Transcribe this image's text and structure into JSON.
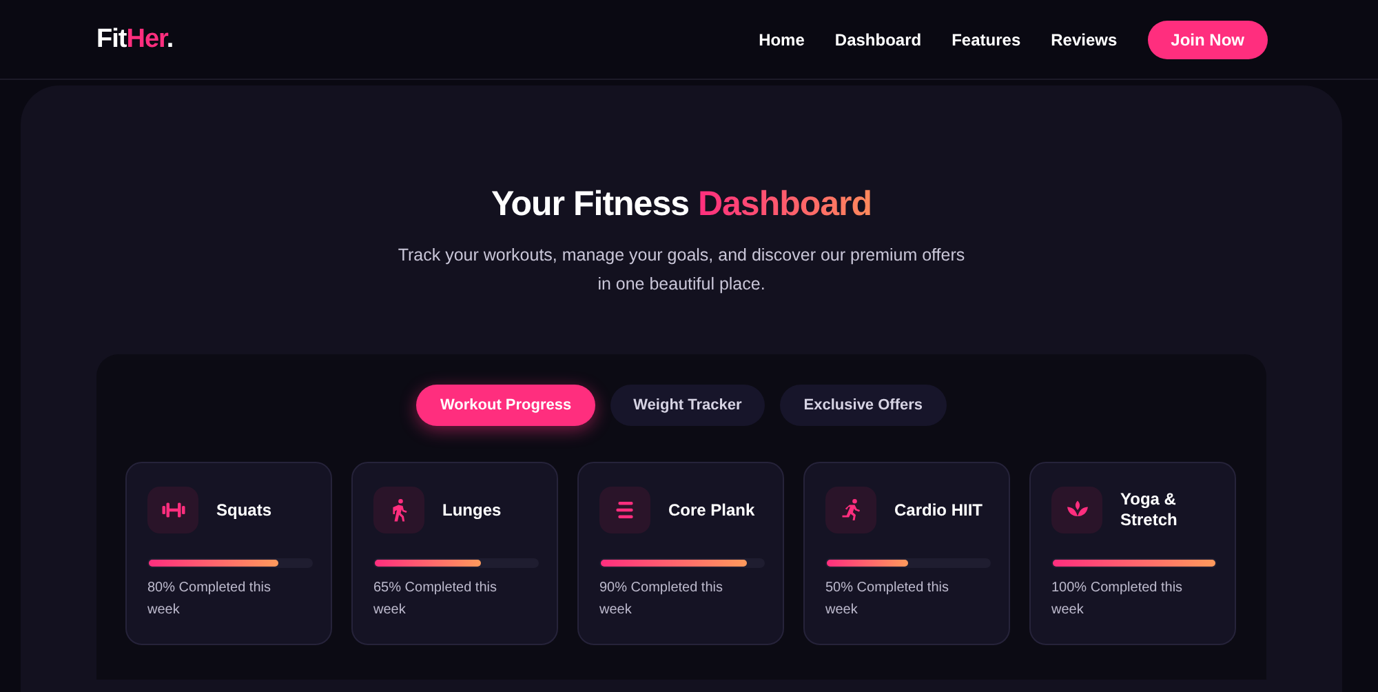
{
  "header": {
    "logo": [
      {
        "text": "Fit",
        "accent": false
      },
      {
        "text": "Her",
        "accent": true
      },
      {
        "text": ".",
        "accent": false
      }
    ],
    "nav": [
      "Home",
      "Dashboard",
      "Features",
      "Reviews"
    ],
    "cta": "Join Now"
  },
  "hero": {
    "title": [
      {
        "text": "Your Fitness ",
        "accent": false
      },
      {
        "text": "Dashboard",
        "accent": true
      }
    ],
    "subtitle": "Track your workouts, manage your goals, and discover our premium offers in one beautiful place."
  },
  "tabs": [
    {
      "label": "Workout Progress",
      "selected": true
    },
    {
      "label": "Weight Tracker",
      "selected": false
    },
    {
      "label": "Exclusive Offers",
      "selected": false
    }
  ],
  "workouts": [
    {
      "kind": "dumbbell",
      "name": "Squats",
      "level": 0.8,
      "caption": "80% Completed this week"
    },
    {
      "kind": "walk",
      "name": "Lunges",
      "level": 0.65,
      "caption": "65% Completed this week"
    },
    {
      "kind": "bars",
      "name": "Core Plank",
      "level": 0.9,
      "caption": "90% Completed this week"
    },
    {
      "kind": "run",
      "name": "Cardio HIIT",
      "level": 0.5,
      "caption": "50% Completed this week"
    },
    {
      "kind": "lotus",
      "name": "Yoga & Stretch",
      "level": 1.0,
      "caption": "100% Completed this week"
    }
  ]
}
